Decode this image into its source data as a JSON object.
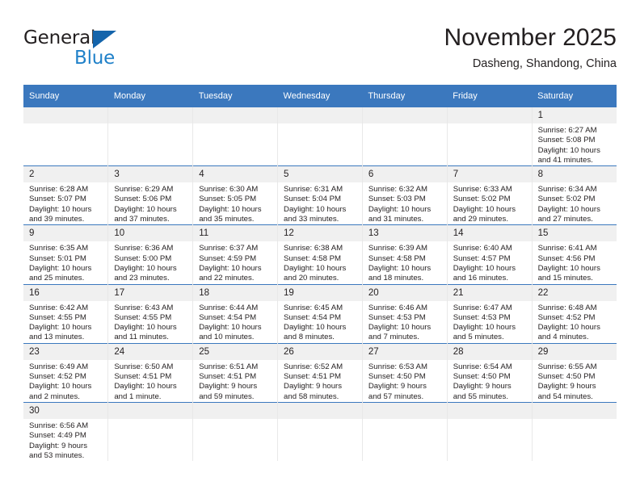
{
  "brand": {
    "name_top": "General",
    "name_bottom": "Blue",
    "accent_color": "#2081c9",
    "triangle_color": "#1464ab"
  },
  "header": {
    "title": "November 2025",
    "subtitle": "Dasheng, Shandong, China"
  },
  "theme": {
    "header_blue": "#3b78be",
    "daynum_band": "#f0f0f0",
    "text": "#231f20"
  },
  "weekday_headers": [
    "Sunday",
    "Monday",
    "Tuesday",
    "Wednesday",
    "Thursday",
    "Friday",
    "Saturday"
  ],
  "labels": {
    "sunrise": "Sunrise:",
    "sunset": "Sunset:",
    "daylight": "Daylight:"
  },
  "weeks": [
    [
      {
        "day": "",
        "blank": true
      },
      {
        "day": "",
        "blank": true
      },
      {
        "day": "",
        "blank": true
      },
      {
        "day": "",
        "blank": true
      },
      {
        "day": "",
        "blank": true
      },
      {
        "day": "",
        "blank": true
      },
      {
        "day": "1",
        "sunrise": "Sunrise: 6:27 AM",
        "sunset": "Sunset: 5:08 PM",
        "daylight_1": "Daylight: 10 hours",
        "daylight_2": "and 41 minutes."
      }
    ],
    [
      {
        "day": "2",
        "sunrise": "Sunrise: 6:28 AM",
        "sunset": "Sunset: 5:07 PM",
        "daylight_1": "Daylight: 10 hours",
        "daylight_2": "and 39 minutes."
      },
      {
        "day": "3",
        "sunrise": "Sunrise: 6:29 AM",
        "sunset": "Sunset: 5:06 PM",
        "daylight_1": "Daylight: 10 hours",
        "daylight_2": "and 37 minutes."
      },
      {
        "day": "4",
        "sunrise": "Sunrise: 6:30 AM",
        "sunset": "Sunset: 5:05 PM",
        "daylight_1": "Daylight: 10 hours",
        "daylight_2": "and 35 minutes."
      },
      {
        "day": "5",
        "sunrise": "Sunrise: 6:31 AM",
        "sunset": "Sunset: 5:04 PM",
        "daylight_1": "Daylight: 10 hours",
        "daylight_2": "and 33 minutes."
      },
      {
        "day": "6",
        "sunrise": "Sunrise: 6:32 AM",
        "sunset": "Sunset: 5:03 PM",
        "daylight_1": "Daylight: 10 hours",
        "daylight_2": "and 31 minutes."
      },
      {
        "day": "7",
        "sunrise": "Sunrise: 6:33 AM",
        "sunset": "Sunset: 5:02 PM",
        "daylight_1": "Daylight: 10 hours",
        "daylight_2": "and 29 minutes."
      },
      {
        "day": "8",
        "sunrise": "Sunrise: 6:34 AM",
        "sunset": "Sunset: 5:02 PM",
        "daylight_1": "Daylight: 10 hours",
        "daylight_2": "and 27 minutes."
      }
    ],
    [
      {
        "day": "9",
        "sunrise": "Sunrise: 6:35 AM",
        "sunset": "Sunset: 5:01 PM",
        "daylight_1": "Daylight: 10 hours",
        "daylight_2": "and 25 minutes."
      },
      {
        "day": "10",
        "sunrise": "Sunrise: 6:36 AM",
        "sunset": "Sunset: 5:00 PM",
        "daylight_1": "Daylight: 10 hours",
        "daylight_2": "and 23 minutes."
      },
      {
        "day": "11",
        "sunrise": "Sunrise: 6:37 AM",
        "sunset": "Sunset: 4:59 PM",
        "daylight_1": "Daylight: 10 hours",
        "daylight_2": "and 22 minutes."
      },
      {
        "day": "12",
        "sunrise": "Sunrise: 6:38 AM",
        "sunset": "Sunset: 4:58 PM",
        "daylight_1": "Daylight: 10 hours",
        "daylight_2": "and 20 minutes."
      },
      {
        "day": "13",
        "sunrise": "Sunrise: 6:39 AM",
        "sunset": "Sunset: 4:58 PM",
        "daylight_1": "Daylight: 10 hours",
        "daylight_2": "and 18 minutes."
      },
      {
        "day": "14",
        "sunrise": "Sunrise: 6:40 AM",
        "sunset": "Sunset: 4:57 PM",
        "daylight_1": "Daylight: 10 hours",
        "daylight_2": "and 16 minutes."
      },
      {
        "day": "15",
        "sunrise": "Sunrise: 6:41 AM",
        "sunset": "Sunset: 4:56 PM",
        "daylight_1": "Daylight: 10 hours",
        "daylight_2": "and 15 minutes."
      }
    ],
    [
      {
        "day": "16",
        "sunrise": "Sunrise: 6:42 AM",
        "sunset": "Sunset: 4:55 PM",
        "daylight_1": "Daylight: 10 hours",
        "daylight_2": "and 13 minutes."
      },
      {
        "day": "17",
        "sunrise": "Sunrise: 6:43 AM",
        "sunset": "Sunset: 4:55 PM",
        "daylight_1": "Daylight: 10 hours",
        "daylight_2": "and 11 minutes."
      },
      {
        "day": "18",
        "sunrise": "Sunrise: 6:44 AM",
        "sunset": "Sunset: 4:54 PM",
        "daylight_1": "Daylight: 10 hours",
        "daylight_2": "and 10 minutes."
      },
      {
        "day": "19",
        "sunrise": "Sunrise: 6:45 AM",
        "sunset": "Sunset: 4:54 PM",
        "daylight_1": "Daylight: 10 hours",
        "daylight_2": "and 8 minutes."
      },
      {
        "day": "20",
        "sunrise": "Sunrise: 6:46 AM",
        "sunset": "Sunset: 4:53 PM",
        "daylight_1": "Daylight: 10 hours",
        "daylight_2": "and 7 minutes."
      },
      {
        "day": "21",
        "sunrise": "Sunrise: 6:47 AM",
        "sunset": "Sunset: 4:53 PM",
        "daylight_1": "Daylight: 10 hours",
        "daylight_2": "and 5 minutes."
      },
      {
        "day": "22",
        "sunrise": "Sunrise: 6:48 AM",
        "sunset": "Sunset: 4:52 PM",
        "daylight_1": "Daylight: 10 hours",
        "daylight_2": "and 4 minutes."
      }
    ],
    [
      {
        "day": "23",
        "sunrise": "Sunrise: 6:49 AM",
        "sunset": "Sunset: 4:52 PM",
        "daylight_1": "Daylight: 10 hours",
        "daylight_2": "and 2 minutes."
      },
      {
        "day": "24",
        "sunrise": "Sunrise: 6:50 AM",
        "sunset": "Sunset: 4:51 PM",
        "daylight_1": "Daylight: 10 hours",
        "daylight_2": "and 1 minute."
      },
      {
        "day": "25",
        "sunrise": "Sunrise: 6:51 AM",
        "sunset": "Sunset: 4:51 PM",
        "daylight_1": "Daylight: 9 hours",
        "daylight_2": "and 59 minutes."
      },
      {
        "day": "26",
        "sunrise": "Sunrise: 6:52 AM",
        "sunset": "Sunset: 4:51 PM",
        "daylight_1": "Daylight: 9 hours",
        "daylight_2": "and 58 minutes."
      },
      {
        "day": "27",
        "sunrise": "Sunrise: 6:53 AM",
        "sunset": "Sunset: 4:50 PM",
        "daylight_1": "Daylight: 9 hours",
        "daylight_2": "and 57 minutes."
      },
      {
        "day": "28",
        "sunrise": "Sunrise: 6:54 AM",
        "sunset": "Sunset: 4:50 PM",
        "daylight_1": "Daylight: 9 hours",
        "daylight_2": "and 55 minutes."
      },
      {
        "day": "29",
        "sunrise": "Sunrise: 6:55 AM",
        "sunset": "Sunset: 4:50 PM",
        "daylight_1": "Daylight: 9 hours",
        "daylight_2": "and 54 minutes."
      }
    ],
    [
      {
        "day": "30",
        "sunrise": "Sunrise: 6:56 AM",
        "sunset": "Sunset: 4:49 PM",
        "daylight_1": "Daylight: 9 hours",
        "daylight_2": "and 53 minutes."
      },
      {
        "day": "",
        "blank": true
      },
      {
        "day": "",
        "blank": true
      },
      {
        "day": "",
        "blank": true
      },
      {
        "day": "",
        "blank": true
      },
      {
        "day": "",
        "blank": true
      },
      {
        "day": "",
        "blank": true
      }
    ]
  ]
}
